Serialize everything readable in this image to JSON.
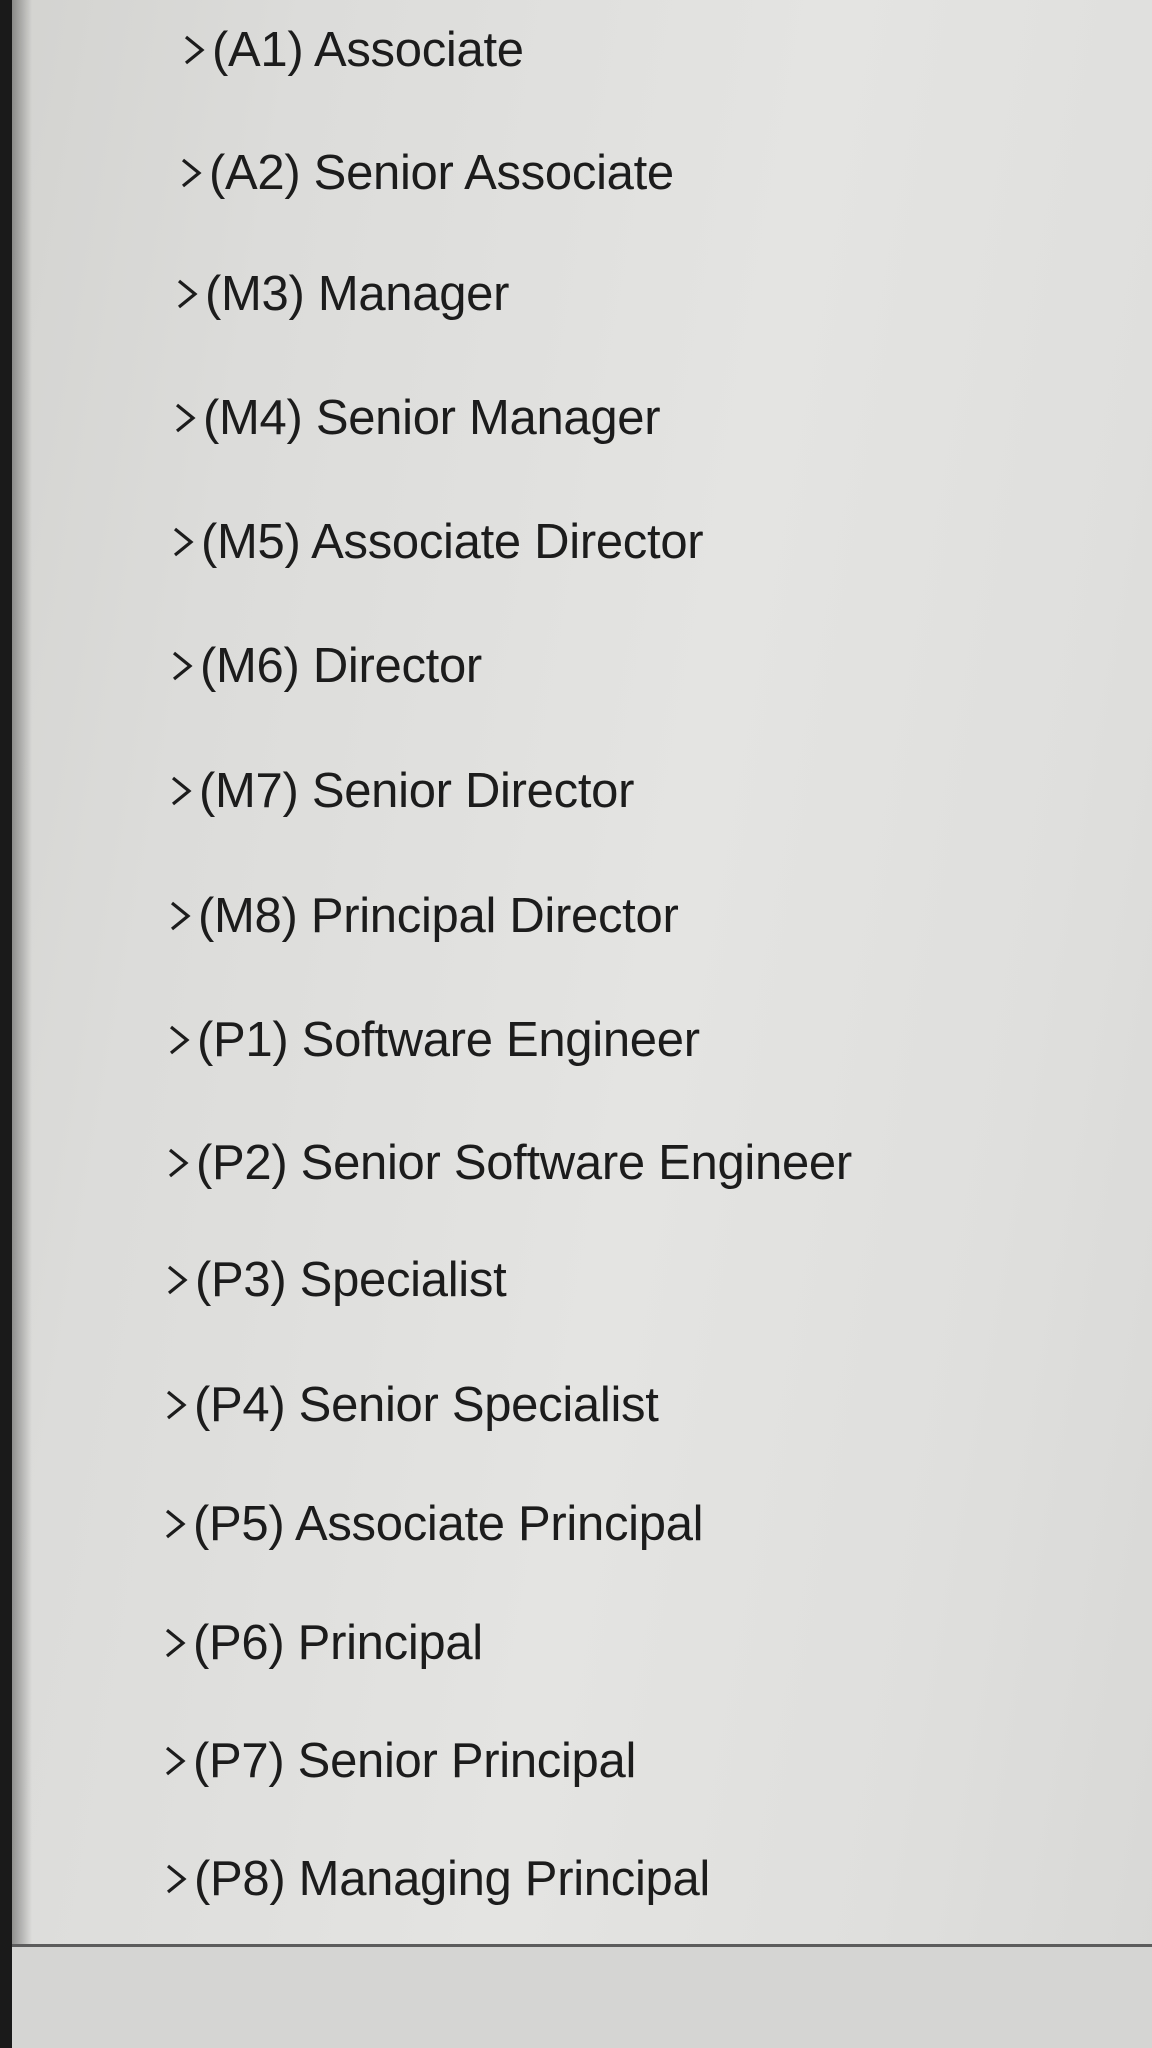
{
  "tree": {
    "items": [
      {
        "label": "(A1) Associate",
        "icon": "chevron-right-icon"
      },
      {
        "label": "(A2) Senior Associate",
        "icon": "chevron-right-icon"
      },
      {
        "label": "(M3) Manager",
        "icon": "chevron-right-icon"
      },
      {
        "label": "(M4) Senior Manager",
        "icon": "chevron-right-icon"
      },
      {
        "label": "(M5) Associate Director",
        "icon": "chevron-right-icon"
      },
      {
        "label": "(M6) Director",
        "icon": "chevron-right-icon"
      },
      {
        "label": "(M7) Senior Director",
        "icon": "chevron-right-icon"
      },
      {
        "label": "(M8) Principal Director",
        "icon": "chevron-right-icon"
      },
      {
        "label": "(P1) Software Engineer",
        "icon": "chevron-right-icon"
      },
      {
        "label": "(P2) Senior Software Engineer",
        "icon": "chevron-right-icon"
      },
      {
        "label": "(P3) Specialist",
        "icon": "chevron-right-icon"
      },
      {
        "label": "(P4) Senior Specialist",
        "icon": "chevron-right-icon"
      },
      {
        "label": "(P5) Associate Principal",
        "icon": "chevron-right-icon"
      },
      {
        "label": "(P6) Principal",
        "icon": "chevron-right-icon"
      },
      {
        "label": "(P7) Senior Principal",
        "icon": "chevron-right-icon"
      },
      {
        "label": "(P8) Managing Principal",
        "icon": "chevron-right-icon"
      }
    ]
  },
  "colors": {
    "text": "#1c1c1c",
    "background": "#e0e0de",
    "divider": "#5c5c5c"
  }
}
